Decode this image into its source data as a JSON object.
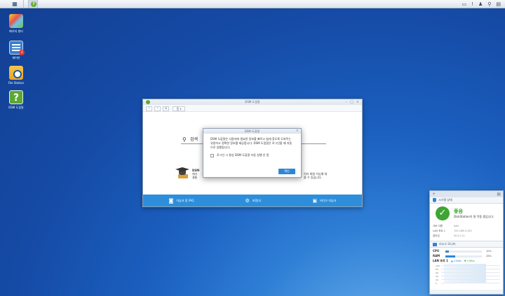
{
  "taskbar": {
    "tray_icons": [
      "chat-icon",
      "notification-icon",
      "user-icon",
      "search-icon",
      "widgets-icon"
    ]
  },
  "desktop": {
    "icons": [
      {
        "label": "패키지 센터",
        "name": "package-center"
      },
      {
        "label": "제어판",
        "name": "control-panel",
        "badge": "3"
      },
      {
        "label": "File Station",
        "name": "file-station"
      },
      {
        "label": "DSM 도움말",
        "name": "dsm-help"
      }
    ]
  },
  "help_window": {
    "title": "DSM 도움말",
    "home_button": "홈",
    "search": {
      "value": "검색"
    },
    "section_title": "DSM",
    "body_left_lines": [
      "에기",
      "결통"
    ],
    "body_right_lines": [
      "이터 최첨 가능해 대",
      "즐 수 있습니다."
    ],
    "footer": [
      {
        "label": "자습서 및 FAQ",
        "icon": "chat-icon"
      },
      {
        "label": "포럼(s)",
        "icon": "gear-icon"
      },
      {
        "label": "비디오 자습서",
        "icon": "video-icon"
      }
    ]
  },
  "dialog": {
    "title": "DSM 도움말",
    "message": "DSM 도움말은 사용자에 필요한 정보를 빠르고 쉽게 찾도록 도와주는 유용하고 정확한 정보를 제공합니다. DSM 도움말은 로그인할 때 자동으로 실행됩니다.",
    "checkbox_label": "로그인 시 항상 DSM 도움말 자동 실행 안 함",
    "ok_label": "확인"
  },
  "widget": {
    "health_title": "시스템 상태",
    "status": "좋음",
    "status_desc": "DiskStation이 잘 작동 중입니다.",
    "info_rows": [
      {
        "key": "서버 이름",
        "value": "NAS"
      },
      {
        "key": "LAN 포트 1",
        "value": "192.168.0.100"
      },
      {
        "key": "업타임",
        "value": "00:11:11"
      }
    ],
    "monitor_title": "리소스 모니터",
    "cpu": {
      "label": "CPU",
      "percent": 10,
      "text": "10%"
    },
    "ram": {
      "label": "RAM",
      "percent": 26,
      "text": "26%"
    },
    "lan": {
      "label": "LAN 포트 1",
      "up": "4 KB/s",
      "down": "3 KB/s"
    },
    "graph_ticks": [
      "100",
      "80",
      "60",
      "40",
      "20",
      "0"
    ]
  }
}
